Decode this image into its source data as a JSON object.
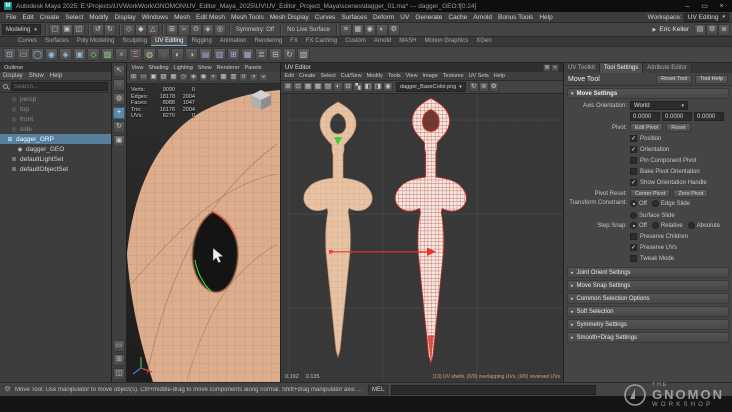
{
  "glyphs": {
    "expand": "▾",
    "collapse": "▸",
    "dropdown": "▾",
    "check": "✓",
    "play": "▶",
    "bullet": "•"
  },
  "window": {
    "title": "Autodesk Maya 2025: E:\\Projects\\UVWorkWork\\GNOMON\\UV_Editor_Maya_2025\\UV\\UV_Editor_Project_Maya\\scenes\\dagger_01.ma* --- dagger_GEO:f[0:24]",
    "app_initial": "M",
    "minimize": "–",
    "maximize": "▭",
    "close": "×"
  },
  "menu_bar": {
    "items": [
      "File",
      "Edit",
      "Create",
      "Select",
      "Modify",
      "Display",
      "Windows",
      "Mesh",
      "Edit Mesh",
      "Mesh Tools",
      "Mesh Display",
      "Curves",
      "Surfaces",
      "Deform",
      "UV",
      "Generate",
      "Cache",
      "Arnold",
      "Bonus Tools",
      "Help"
    ],
    "workspace_label": "Workspace:",
    "workspace_value": "UV Editing"
  },
  "status_line": {
    "mode": "Modeling",
    "symmetry_label": "Symmetry: Off",
    "live_surface_label": "No Live Surface",
    "presenter": "Eric Keller",
    "file_icons": [
      {
        "n": "new-scene-icon",
        "g": "▢"
      },
      {
        "n": "open-scene-icon",
        "g": "▣"
      },
      {
        "n": "save-scene-icon",
        "g": "◫"
      }
    ],
    "edit_icons": [
      {
        "n": "undo-icon",
        "g": "↺"
      },
      {
        "n": "redo-icon",
        "g": "↻"
      }
    ],
    "selection_icons": [
      {
        "n": "select-hierarchy-icon",
        "g": "◇"
      },
      {
        "n": "select-object-icon",
        "g": "◆"
      },
      {
        "n": "select-component-icon",
        "g": "△"
      }
    ],
    "snap_icons": [
      {
        "n": "snap-grid-icon",
        "g": "⊞"
      },
      {
        "n": "snap-curve-icon",
        "g": "≈"
      },
      {
        "n": "snap-point-icon",
        "g": "⊙"
      },
      {
        "n": "snap-plane-icon",
        "g": "◈"
      },
      {
        "n": "make-live-icon",
        "g": "◎"
      }
    ],
    "render_icons": [
      {
        "n": "construction-history-icon",
        "g": "≡"
      },
      {
        "n": "render-view-icon",
        "g": "▦"
      },
      {
        "n": "render-current-frame-icon",
        "g": "◉"
      },
      {
        "n": "ipr-render-icon",
        "g": "◐"
      },
      {
        "n": "render-settings-icon",
        "g": "⚙"
      }
    ],
    "sidebar_icons": [
      {
        "n": "attribute-editor-toggle-icon",
        "g": "▤"
      },
      {
        "n": "tool-settings-toggle-icon",
        "g": "⚙"
      },
      {
        "n": "channel-box-toggle-icon",
        "g": "≣"
      }
    ]
  },
  "shelf": {
    "tabs": [
      {
        "label": "Curves"
      },
      {
        "label": "Surfaces"
      },
      {
        "label": "Poly Modeling"
      },
      {
        "label": "Sculpting"
      },
      {
        "label": "UV Editing",
        "active": true
      },
      {
        "label": "Rigging"
      },
      {
        "label": "Animation"
      },
      {
        "label": "Rendering"
      },
      {
        "label": "FX"
      },
      {
        "label": "FX Caching"
      },
      {
        "label": "Custom"
      },
      {
        "label": "Arnold"
      },
      {
        "label": "MASH"
      },
      {
        "label": "Motion Graphics"
      },
      {
        "label": "XGen"
      }
    ],
    "icons": [
      {
        "n": "open-uv-editor-icon",
        "g": "⊡",
        "c": "#8fc1dd"
      },
      {
        "n": "planar-projection-icon",
        "g": "▭",
        "c": "#8fc1dd"
      },
      {
        "n": "cylindrical-projection-icon",
        "g": "◯",
        "c": "#8fc1dd"
      },
      {
        "n": "spherical-projection-icon",
        "g": "◉",
        "c": "#8fc1dd"
      },
      {
        "n": "automatic-projection-icon",
        "g": "◈",
        "c": "#8fc1dd"
      },
      {
        "n": "camera-projection-icon",
        "g": "▣",
        "c": "#8fc1dd"
      },
      {
        "n": "normal-projection-icon",
        "g": "◇",
        "c": "#9fd49f"
      },
      {
        "n": "contour-stretch-icon",
        "g": "▨",
        "c": "#9fd49f"
      },
      {
        "n": "cut-uv-icon",
        "g": "×",
        "c": "#e89a7a"
      },
      {
        "n": "sew-uv-icon",
        "g": "Ξ",
        "c": "#e89a7a"
      },
      {
        "n": "grab-uv-icon",
        "g": "◍",
        "c": "#d8c47f"
      },
      {
        "n": "pinch-uv-icon",
        "g": "◌",
        "c": "#d8c47f"
      },
      {
        "n": "smudge-uv-icon",
        "g": "◐",
        "c": "#d8c47f"
      },
      {
        "n": "symmetrize-uv-icon",
        "g": "◑",
        "c": "#d8c47f"
      },
      {
        "n": "unfold-uv-icon",
        "g": "▤",
        "c": "#b9a5dd"
      },
      {
        "n": "optimize-uv-icon",
        "g": "▥",
        "c": "#b9a5dd"
      },
      {
        "n": "layout-uv-icon",
        "g": "⊞",
        "c": "#b9a5dd"
      },
      {
        "n": "straighten-shell-icon",
        "g": "▦",
        "c": "#b9a5dd"
      },
      {
        "n": "align-uv-icon",
        "g": "≣",
        "c": "#c0c0c0"
      },
      {
        "n": "stack-shells-icon",
        "g": "⊟",
        "c": "#c0c0c0"
      },
      {
        "n": "orient-shells-icon",
        "g": "↻",
        "c": "#c0c0c0"
      },
      {
        "n": "uv-snapshot-icon",
        "g": "▧",
        "c": "#c0c0c0"
      }
    ]
  },
  "outliner": {
    "panel_title": "Outliner",
    "menus": [
      "Display",
      "Show",
      "Help"
    ],
    "search_placeholder": "Search...",
    "items": [
      {
        "icon": "◎",
        "label": "persp",
        "pad": "10px",
        "dim": true
      },
      {
        "icon": "◎",
        "label": "top",
        "pad": "10px",
        "dim": true
      },
      {
        "icon": "◎",
        "label": "front",
        "pad": "10px",
        "dim": true
      },
      {
        "icon": "◎",
        "label": "side",
        "pad": "10px",
        "dim": true
      },
      {
        "icon": "⊞",
        "label": "dagger_GRP",
        "pad": "6px",
        "selected": true
      },
      {
        "icon": "◆",
        "label": "dagger_GEO",
        "pad": "16px"
      },
      {
        "icon": "≣",
        "label": "defaultLightSet",
        "pad": "10px"
      },
      {
        "icon": "≣",
        "label": "defaultObjectSet",
        "pad": "10px"
      }
    ]
  },
  "toolbox": {
    "tools": [
      {
        "n": "select-tool-icon",
        "g": "↖"
      },
      {
        "n": "lasso-tool-icon",
        "g": "◌"
      },
      {
        "n": "paint-select-tool-icon",
        "g": "◍"
      },
      {
        "n": "move-tool-icon",
        "g": "+",
        "active": true
      },
      {
        "n": "rotate-tool-icon",
        "g": "↻"
      },
      {
        "n": "scale-tool-icon",
        "g": "▣"
      }
    ],
    "layouts": [
      {
        "n": "layout-single-pane-icon",
        "g": "▭"
      },
      {
        "n": "layout-four-pane-icon",
        "g": "⊞"
      },
      {
        "n": "layout-two-pane-icon",
        "g": "◫"
      }
    ]
  },
  "viewport": {
    "menus": [
      "View",
      "Shading",
      "Lighting",
      "Show",
      "Renderer",
      "Panels"
    ],
    "toolbar_icons": [
      {
        "n": "grid-toggle-icon",
        "g": "⊞"
      },
      {
        "n": "film-gate-icon",
        "g": "▭"
      },
      {
        "n": "resolution-gate-icon",
        "g": "▣"
      },
      {
        "n": "gate-mask-icon",
        "g": "▨"
      },
      {
        "n": "field-chart-icon",
        "g": "▦"
      },
      {
        "n": "safe-action-icon",
        "g": "◇"
      },
      {
        "n": "safe-title-icon",
        "g": "◈"
      },
      {
        "n": "isolate-select-icon",
        "g": "◉"
      },
      {
        "n": "xray-icon",
        "g": "◐"
      },
      {
        "n": "wireframe-on-shaded-icon",
        "g": "▩"
      },
      {
        "n": "textured-icon",
        "g": "▥"
      },
      {
        "n": "lighting-icon",
        "g": "¤"
      },
      {
        "n": "shadows-icon",
        "g": "◑"
      },
      {
        "n": "ssao-icon",
        "g": "◒"
      }
    ],
    "hud_rows": [
      {
        "label": "Verts:",
        "v1": "9090",
        "v2": "0"
      },
      {
        "label": "Edges:",
        "v1": "18178",
        "v2": "2004"
      },
      {
        "label": "Faces:",
        "v1": "8088",
        "v2": "1047"
      },
      {
        "label": "Tris:",
        "v1": "16176",
        "v2": "2004"
      },
      {
        "label": "UVs:",
        "v1": "8270",
        "v2": "0"
      }
    ]
  },
  "uv_editor": {
    "panel_title": "UV Editor",
    "title_icons": [
      {
        "n": "panel-menu-icon",
        "g": "≣"
      },
      {
        "n": "panel-close-icon",
        "g": "×"
      }
    ],
    "menus": [
      "Edit",
      "Create",
      "Select",
      "Cut/Sew",
      "Modify",
      "Tools",
      "View",
      "Image",
      "Textures",
      "UV Sets",
      "Help"
    ],
    "toolbar_icons_left": [
      {
        "n": "uv-snap-grid-icon",
        "g": "⊞"
      },
      {
        "n": "uv-snap-pixel-icon",
        "g": "⊡"
      },
      {
        "n": "uv-tile-grid-icon",
        "g": "▦"
      },
      {
        "n": "uv-texture-borders-icon",
        "g": "▩"
      },
      {
        "n": "uv-display-image-icon",
        "g": "▨"
      },
      {
        "n": "uv-dim-image-icon",
        "g": "◐"
      },
      {
        "n": "uv-view-grid-icon",
        "g": "⊟"
      },
      {
        "n": "uv-checker-icon",
        "g": "▚"
      },
      {
        "n": "uv-distortion-icon",
        "g": "◧"
      },
      {
        "n": "uv-solid-map-icon",
        "g": "◨"
      },
      {
        "n": "uv-isolate-icon",
        "g": "◉"
      }
    ],
    "texture_selector": "dagger_BaseColor.png",
    "toolbar_icons_right": [
      {
        "n": "uv-refresh-icon",
        "g": "↻"
      },
      {
        "n": "uv-baking-icon",
        "g": "⊚"
      },
      {
        "n": "uv-options-icon",
        "g": "⚙"
      }
    ],
    "coord_u": "0.192",
    "coord_v": "0.135",
    "status_right": "(13) UV shells, (0/0) overlapping UVs, (0/0) reversed UVs"
  },
  "tool_settings": {
    "tabs": [
      {
        "label": "UV Toolkit"
      },
      {
        "label": "Tool Settings",
        "active": true
      },
      {
        "label": "Attribute Editor"
      }
    ],
    "tool_name": "Move Tool",
    "reset_button": "Reset Tool",
    "help_button": "Tool Help",
    "move": {
      "header": "Move Settings",
      "axis_label": "Axis Orientation:",
      "axis_value": "World",
      "fields": [
        "0.0000",
        "0.0000",
        "0.0000"
      ],
      "pivot_label": "Pivot:",
      "pivot_btn1": "Edit Pivot",
      "pivot_btn2": "Reset",
      "checkboxes": [
        {
          "label": "Position",
          "checked": true
        },
        {
          "label": "Orientation",
          "checked": true
        },
        {
          "label": "Pin Component Pivot"
        },
        {
          "label": "Bake Pivot Orientation"
        },
        {
          "label": "Show Orientation Handle",
          "checked": true
        }
      ],
      "pivot_reset_label": "Pivot Reset:",
      "pivot_reset_btn1": "Center Pivot",
      "pivot_reset_btn2": "Zero Pivot",
      "constraint_label": "Transform Constraint:",
      "constraint_options": [
        {
          "label": "Off",
          "selected": true
        },
        {
          "label": "Edge Slide"
        },
        {
          "label": "Surface Slide"
        }
      ],
      "step_label": "Step Snap:",
      "step_options": [
        {
          "label": "Off",
          "selected": true
        },
        {
          "label": "Relative"
        },
        {
          "label": "Absolute"
        }
      ],
      "post_checkboxes": [
        {
          "label": "Preserve Children"
        },
        {
          "label": "Preserve UVs",
          "checked": true
        },
        {
          "label": "Tweak Mode"
        }
      ],
      "collapsed_sections": [
        "Joint Orient Settings",
        "Move Snap Settings",
        "Common Selection Options",
        "Soft Selection",
        "Symmetry Settings",
        "Smooth+Drag Settings"
      ]
    }
  },
  "bottom_bar": {
    "help_icon": "◇",
    "help_text": "Move Tool: Use manipulator to move object(s). Ctrl+middle-drag to move components along normal. Shift+drag manipulator axis or plane handles to extrude components or clone objects. Ctrl+Shift+drag to snap...",
    "command_label": "MEL"
  },
  "watermark": {
    "the": "THE",
    "name": "GNOMON",
    "sub": "WORKSHOP"
  },
  "colors": {
    "selection_blue": "#56809e",
    "wire_red": "#cf3a30",
    "mesh_tan": "#dcae8d",
    "uv_tan": "#e7c3a4",
    "green_select": "#35d435"
  }
}
